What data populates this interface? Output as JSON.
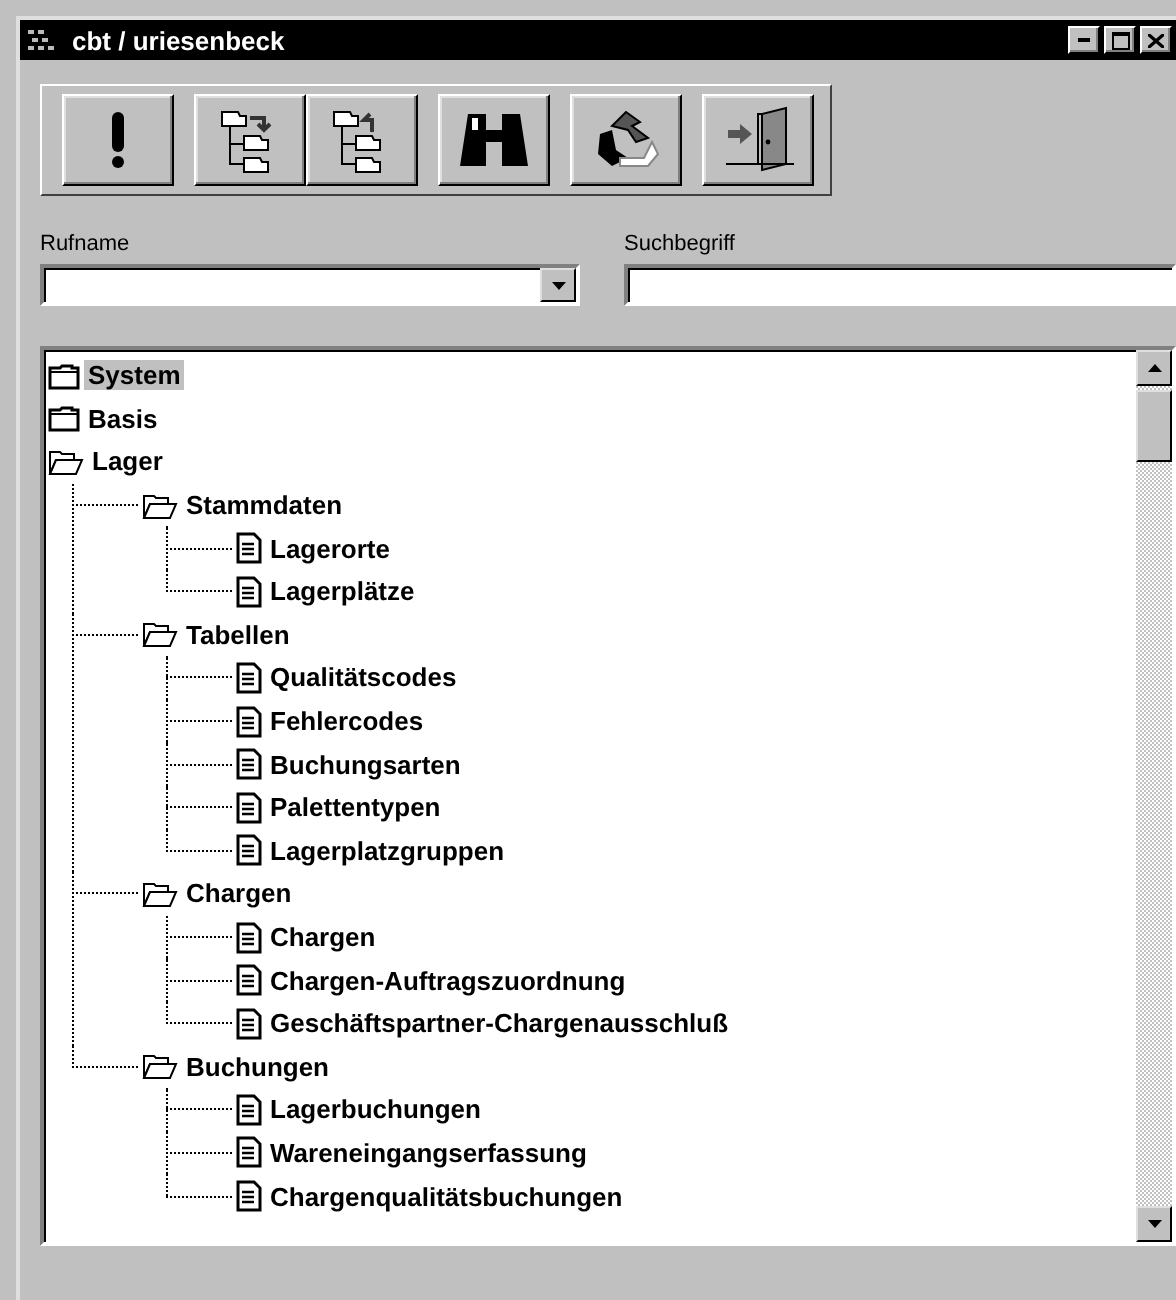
{
  "window": {
    "title": "cbt / uriesenbeck"
  },
  "fields": [
    {
      "label": "Rufname",
      "kind": "dropdown"
    },
    {
      "label": "Suchbegriff",
      "kind": "text"
    }
  ],
  "tree": [
    {
      "label": "System",
      "kind": "folder",
      "expanded": false,
      "selected": true
    },
    {
      "label": "Basis",
      "kind": "folder",
      "expanded": false,
      "selected": false
    },
    {
      "label": "Lager",
      "kind": "folder",
      "expanded": true,
      "selected": false,
      "children": [
        {
          "label": "Stammdaten",
          "kind": "folder",
          "expanded": true,
          "selected": false,
          "children": [
            {
              "label": "Lagerorte",
              "kind": "document",
              "selected": false
            },
            {
              "label": "Lagerplätze",
              "kind": "document",
              "selected": false
            }
          ]
        },
        {
          "label": "Tabellen",
          "kind": "folder",
          "expanded": true,
          "selected": false,
          "children": [
            {
              "label": "Qualitätscodes",
              "kind": "document",
              "selected": false
            },
            {
              "label": "Fehlercodes",
              "kind": "document",
              "selected": false
            },
            {
              "label": "Buchungsarten",
              "kind": "document",
              "selected": false
            },
            {
              "label": "Palettentypen",
              "kind": "document",
              "selected": false
            },
            {
              "label": "Lagerplatzgruppen",
              "kind": "document",
              "selected": false
            }
          ]
        },
        {
          "label": "Chargen",
          "kind": "folder",
          "expanded": true,
          "selected": false,
          "children": [
            {
              "label": "Chargen",
              "kind": "document",
              "selected": false
            },
            {
              "label": "Chargen-Auftragszuordnung",
              "kind": "document",
              "selected": false
            },
            {
              "label": "Geschäftspartner-Chargenausschluß",
              "kind": "document",
              "selected": false
            }
          ]
        },
        {
          "label": "Buchungen",
          "kind": "folder",
          "expanded": true,
          "selected": false,
          "children": [
            {
              "label": "Lagerbuchungen",
              "kind": "document",
              "selected": false
            },
            {
              "label": "Wareneingangserfassung",
              "kind": "document",
              "selected": false
            },
            {
              "label": "Chargenqualitätsbuchungen",
              "kind": "document",
              "selected": false
            }
          ]
        }
      ]
    }
  ]
}
